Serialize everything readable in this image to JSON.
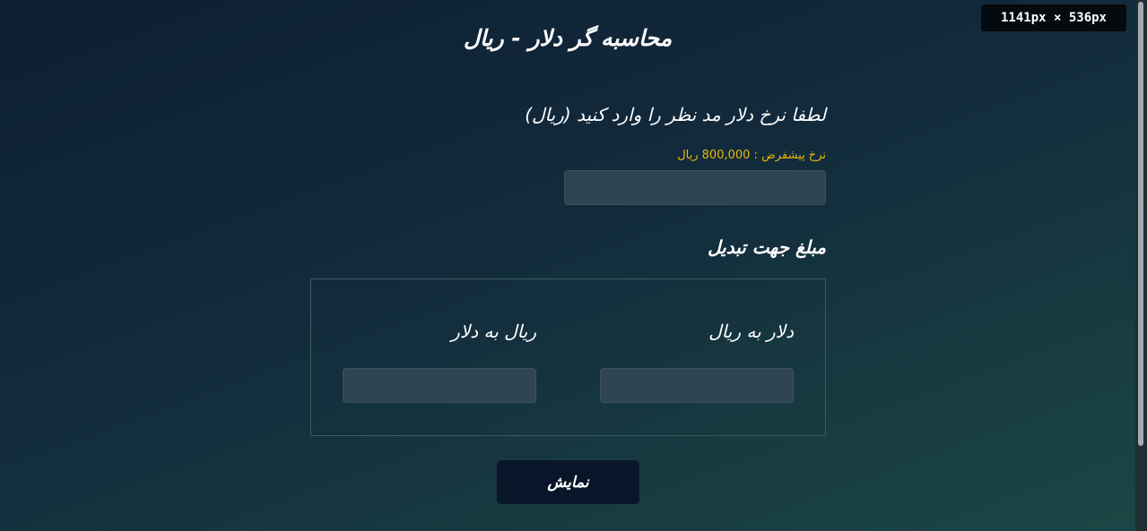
{
  "overlay": {
    "dimensions_badge": "1141px × 536px"
  },
  "header": {
    "title": "محاسبه گر دلار - ریال"
  },
  "rate": {
    "label": "لطفا نرخ دلار مد نظر را وارد کنید (ریال)",
    "hint": "نرخ پیشفرض : 800,000 ریال",
    "value": "",
    "placeholder": ""
  },
  "conversion": {
    "section_label": "مبلغ جهت تبدیل",
    "usd_to_rial": {
      "label": "دلار به ریال",
      "value": "",
      "placeholder": ""
    },
    "rial_to_usd": {
      "label": "ریال به دلار",
      "value": "",
      "placeholder": ""
    }
  },
  "actions": {
    "show_label": "نمایش"
  },
  "colors": {
    "background_start": "#0d1e33",
    "background_end": "#1b4745",
    "hint_color": "#e8b80a",
    "input_bg": "#2f4551",
    "button_bg": "#091629",
    "box_border": "#3c5b63"
  }
}
